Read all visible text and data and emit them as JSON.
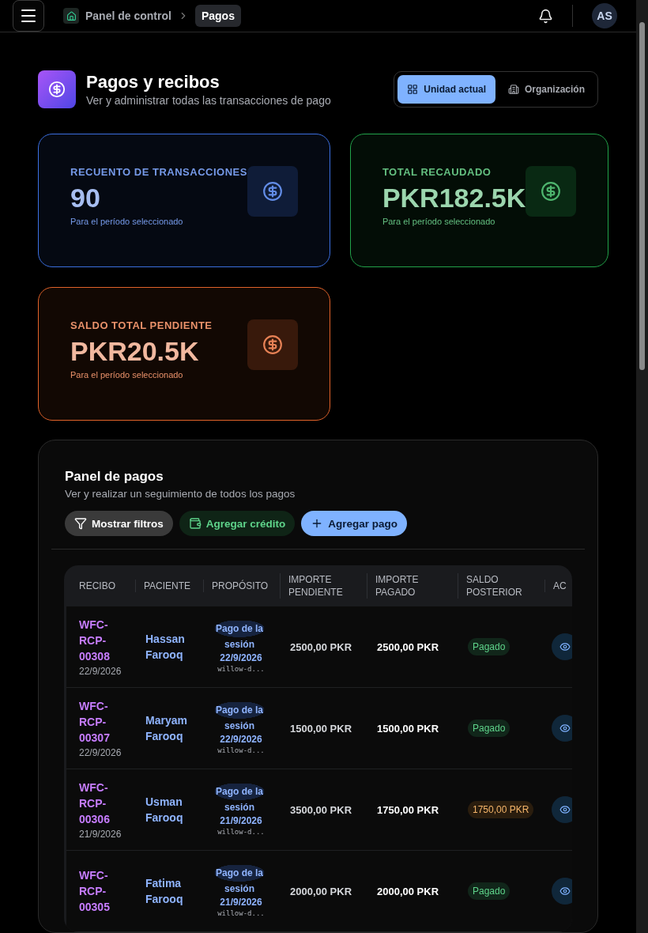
{
  "header": {
    "breadcrumb": [
      {
        "label": "Panel de control",
        "selected": false
      },
      {
        "label": "Pagos",
        "selected": true
      }
    ],
    "avatar": "AS"
  },
  "page": {
    "title": "Pagos y recibos",
    "subtitle": "Ver y administrar todas las transacciones de pago"
  },
  "scope_toggle": [
    {
      "label": "Unidad actual",
      "selected": true
    },
    {
      "label": "Organización",
      "selected": false
    }
  ],
  "stats": [
    {
      "label": "RECUENTO DE TRANSACCIONES",
      "value": "90",
      "note": "Para el período seleccionado",
      "color": "#3b6fe0"
    },
    {
      "label": "TOTAL RECAUDADO",
      "value": "PKR182.5K",
      "note": "Para el período seleccionado",
      "color": "#22a34a"
    },
    {
      "label": "SALDO TOTAL PENDIENTE",
      "value": "PKR20.5K",
      "note": "Para el período seleccionado",
      "color": "#e0622a"
    }
  ],
  "panel": {
    "title": "Panel de pagos",
    "subtitle": "Ver y realizar un seguimiento de todos los pagos",
    "buttons": [
      {
        "label": "Mostrar filtros",
        "kind": "filter"
      },
      {
        "label": "Agregar crédito",
        "kind": "credit"
      },
      {
        "label": "Agregar pago",
        "kind": "add"
      }
    ]
  },
  "table": {
    "columns": [
      "RECIBO",
      "PACIENTE",
      "PROPÓSITO",
      "IMPORTE PENDIENTE",
      "IMPORTE PAGADO",
      "SALDO POSTERIOR",
      "AC"
    ],
    "rows": [
      {
        "receipt": "WFC-RCP-00308",
        "date": "22/9/2026",
        "patient": "Hassan Farooq",
        "purpose": "Pago de la sesión",
        "purpose_date": "22/9/2026",
        "reference": "willow-d...",
        "pending": "2500,00 PKR",
        "paid": "2500,00 PKR",
        "balance": {
          "text": "Pagado",
          "kind": "paid"
        }
      },
      {
        "receipt": "WFC-RCP-00307",
        "date": "22/9/2026",
        "patient": "Maryam Farooq",
        "purpose": "Pago de la sesión",
        "purpose_date": "22/9/2026",
        "reference": "willow-d...",
        "pending": "1500,00 PKR",
        "paid": "1500,00 PKR",
        "balance": {
          "text": "Pagado",
          "kind": "paid"
        }
      },
      {
        "receipt": "WFC-RCP-00306",
        "date": "21/9/2026",
        "patient": "Usman Farooq",
        "purpose": "Pago de la sesión",
        "purpose_date": "21/9/2026",
        "reference": "willow-d...",
        "pending": "3500,00 PKR",
        "paid": "1750,00 PKR",
        "balance": {
          "text": "1750,00 PKR",
          "kind": "due"
        }
      },
      {
        "receipt": "WFC-RCP-00305",
        "patient": "Fatima Farooq",
        "purpose": "Pago de la sesión",
        "purpose_date": "21/9/2026",
        "reference": "willow-d...",
        "pending": "2000,00 PKR",
        "paid": "2000,00 PKR",
        "balance": {
          "text": "Pagado",
          "kind": "paid"
        }
      }
    ]
  }
}
